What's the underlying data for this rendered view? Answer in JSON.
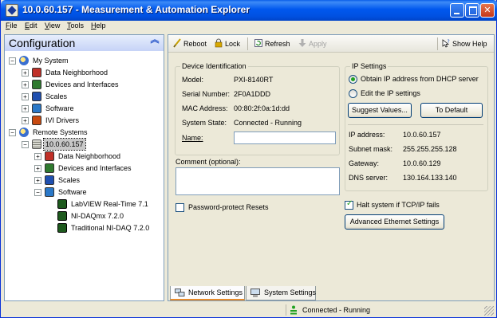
{
  "window": {
    "title": "10.0.60.157 - Measurement & Automation Explorer"
  },
  "menu": [
    "File",
    "Edit",
    "View",
    "Tools",
    "Help"
  ],
  "left_pane": {
    "header": "Configuration",
    "tree": [
      {
        "label": "My System",
        "level": 0,
        "expander": "−",
        "icon": "computer-icon"
      },
      {
        "label": "Data Neighborhood",
        "level": 1,
        "expander": "+",
        "icon": "data-neighborhood-icon"
      },
      {
        "label": "Devices and Interfaces",
        "level": 1,
        "expander": "+",
        "icon": "devices-icon"
      },
      {
        "label": "Scales",
        "level": 1,
        "expander": "+",
        "icon": "scales-icon"
      },
      {
        "label": "Software",
        "level": 1,
        "expander": "+",
        "icon": "software-icon"
      },
      {
        "label": "IVI Drivers",
        "level": 1,
        "expander": "+",
        "icon": "ivi-drivers-icon"
      },
      {
        "label": "Remote Systems",
        "level": 0,
        "expander": "−",
        "icon": "remote-systems-icon"
      },
      {
        "label": "10.0.60.157",
        "level": 1,
        "expander": "−",
        "icon": "pxi-target-icon",
        "selected": true
      },
      {
        "label": "Data Neighborhood",
        "level": 2,
        "expander": "+",
        "icon": "data-neighborhood-icon"
      },
      {
        "label": "Devices and Interfaces",
        "level": 2,
        "expander": "+",
        "icon": "devices-icon"
      },
      {
        "label": "Scales",
        "level": 2,
        "expander": "+",
        "icon": "scales-icon"
      },
      {
        "label": "Software",
        "level": 2,
        "expander": "−",
        "icon": "software-icon"
      },
      {
        "label": "LabVIEW Real-Time 7.1",
        "level": 3,
        "expander": "",
        "icon": "software-package-icon"
      },
      {
        "label": "NI-DAQmx 7.2.0",
        "level": 3,
        "expander": "",
        "icon": "software-package-icon"
      },
      {
        "label": "Traditional NI-DAQ 7.2.0",
        "level": 3,
        "expander": "",
        "icon": "software-package-icon"
      }
    ]
  },
  "toolbar": {
    "reboot": "Reboot",
    "lock": "Lock",
    "refresh": "Refresh",
    "apply": "Apply",
    "show_help": "Show Help"
  },
  "device_identification": {
    "title": "Device Identification",
    "model_label": "Model:",
    "model": "PXI-8140RT",
    "serial_label": "Serial Number:",
    "serial": "2F0A1DDD",
    "mac_label": "MAC Address:",
    "mac": "00:80:2f:0a:1d:dd",
    "state_label": "System State:",
    "state": "Connected - Running",
    "name_label": "Name:",
    "name_value": ""
  },
  "comment": {
    "label": "Comment (optional):",
    "value": ""
  },
  "password_protect": {
    "label": "Password-protect Resets",
    "checked": false
  },
  "ip_settings": {
    "title": "IP Settings",
    "dhcp_label": "Obtain IP address from DHCP server",
    "dhcp_selected": true,
    "edit_label": "Edit  the IP settings",
    "suggest_button": "Suggest Values...",
    "default_button": "To Default",
    "ip_label": "IP address:",
    "ip": "10.0.60.157",
    "subnet_label": "Subnet mask:",
    "subnet": "255.255.255.128",
    "gateway_label": "Gateway:",
    "gateway": "10.0.60.129",
    "dns_label": "DNS server:",
    "dns": "130.164.133.140"
  },
  "halt_on_fail": {
    "label": "Halt system if TCP/IP fails",
    "checked": true
  },
  "advanced_button": "Advanced Ethernet Settings",
  "tabs": [
    {
      "label": "Network Settings",
      "active": true
    },
    {
      "label": "System Settings",
      "active": false
    }
  ],
  "status": {
    "text": "Connected - Running"
  },
  "colors": {
    "titlebar": "#0058ee",
    "selection": "#c8c8c8",
    "status_ok": "#21a121"
  }
}
